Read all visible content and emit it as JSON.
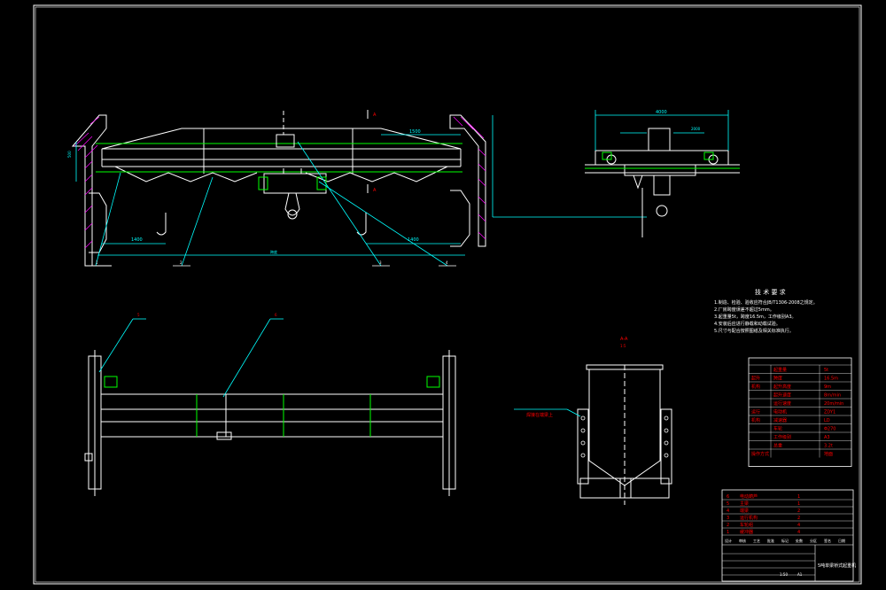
{
  "drawing": {
    "colors": {
      "background": "#000000",
      "line": "#ffffff",
      "dimension": "#00ffff",
      "centerline": "#ffffff",
      "green": "#00ff00",
      "red": "#ff0000",
      "yellow": "#ffff00",
      "hatch": "#ff00ff"
    }
  },
  "front_view": {
    "dim_center": "1500",
    "dim_left": "1400",
    "dim_right": "1400",
    "dim_left_vertical": "500",
    "balloon_1": "1",
    "balloon_2": "2",
    "balloon_3": "3",
    "balloon_4": "4",
    "section_mark_top": "A",
    "section_mark_bottom": "A",
    "span_label": "跨度"
  },
  "side_view": {
    "dim_top": "4000",
    "dim_mid": "2000"
  },
  "plan_view": {
    "balloon_5": "5",
    "balloon_6": "6"
  },
  "section_view": {
    "title": "A-A",
    "subtitle": "1:5",
    "callout": "焊接在端梁上"
  },
  "tech_requirements": {
    "title": "技 术 要 求",
    "items": [
      "1.制造、检验、验收应符合JB/T1306-2008之规定。",
      "2.厂房跨度误差不超过5mm。",
      "3.起重量5t，跨度16.5m，工作级别A3。",
      "4.安装后应进行静载和动载试验。",
      "5.尺寸与配合按照图纸及相关标准执行。"
    ]
  },
  "param_table": {
    "rows": [
      {
        "group": "",
        "name": "起重量",
        "value": "5t"
      },
      {
        "group": "起升",
        "name": "跨度",
        "value": "16.5m"
      },
      {
        "group": "机构",
        "name": "起升高度",
        "value": "9m"
      },
      {
        "group": "",
        "name": "起升速度",
        "value": "8m/min"
      },
      {
        "group": "",
        "name": "运行速度",
        "value": "20m/min"
      },
      {
        "group": "运行",
        "name": "电动机",
        "value": "ZDY1"
      },
      {
        "group": "机构",
        "name": "减速器",
        "value": "LD"
      },
      {
        "group": "",
        "name": "车轮",
        "value": "Φ270"
      },
      {
        "group": "",
        "name": "工作级别",
        "value": "A3"
      },
      {
        "group": "",
        "name": "总重",
        "value": "3.2t"
      },
      {
        "group": "操作方式",
        "name": "",
        "value": "地面"
      }
    ]
  },
  "title_block": {
    "drawing_title": "5吨单梁桥式起重机",
    "scale": "1:50",
    "sheet": "A1",
    "labels": [
      "设计",
      "审核",
      "工艺",
      "批准",
      "标记",
      "处数",
      "分区",
      "签名",
      "日期"
    ],
    "parts_rows": [
      {
        "no": "6",
        "name": "电动葫芦",
        "qty": "1"
      },
      {
        "no": "5",
        "name": "主梁",
        "qty": "1"
      },
      {
        "no": "4",
        "name": "端梁",
        "qty": "2"
      },
      {
        "no": "3",
        "name": "运行机构",
        "qty": "2"
      },
      {
        "no": "2",
        "name": "车轮组",
        "qty": "4"
      },
      {
        "no": "1",
        "name": "缓冲器",
        "qty": "4"
      }
    ]
  }
}
